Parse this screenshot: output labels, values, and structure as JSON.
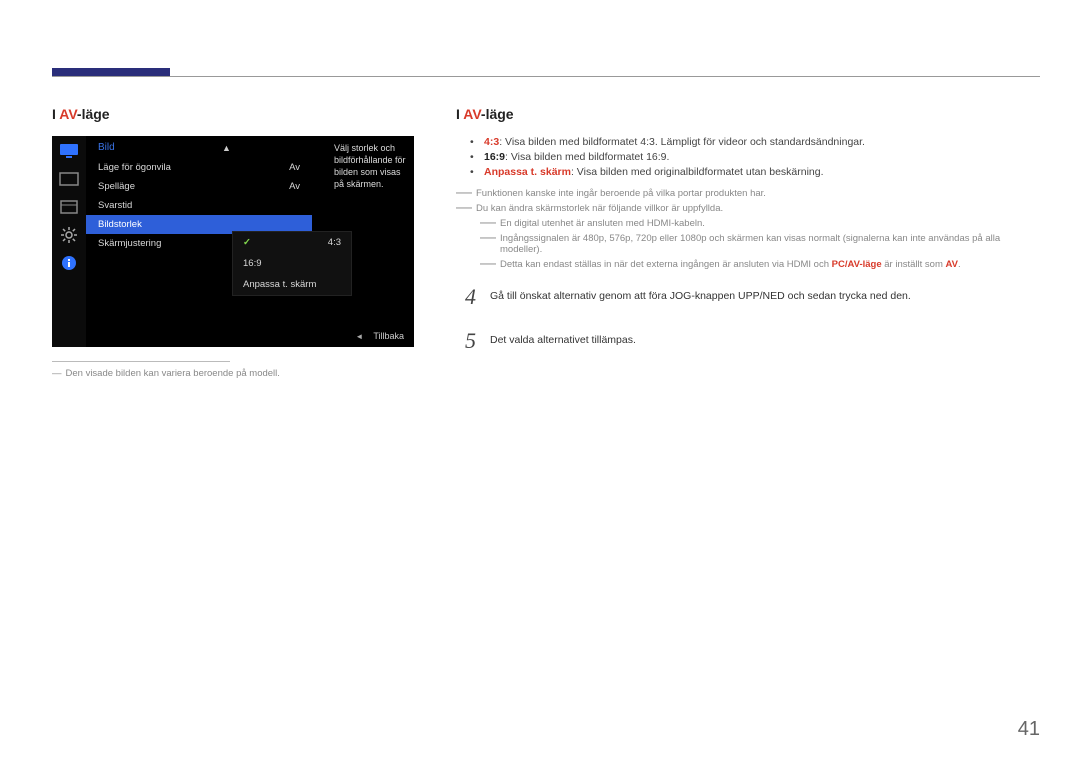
{
  "page_number": "41",
  "left": {
    "heading_prefix": "I ",
    "heading_accent": "AV",
    "heading_suffix": "-läge",
    "osd": {
      "title": "Bild",
      "help": "Välj storlek och bildförhållande för bilden som visas på skärmen.",
      "rows": [
        {
          "label": "Läge för ögonvila",
          "value": "Av"
        },
        {
          "label": "Spelläge",
          "value": "Av"
        },
        {
          "label": "Svarstid",
          "value": ""
        },
        {
          "label": "Bildstorlek",
          "value": ""
        },
        {
          "label": "Skärmjustering",
          "value": ""
        }
      ],
      "selected_index": 3,
      "submenu": [
        "4:3",
        "16:9",
        "Anpassa t. skärm"
      ],
      "submenu_selected": 0,
      "footer_back": "Tillbaka"
    },
    "footnote": "Den visade bilden kan variera beroende på modell."
  },
  "right": {
    "heading_prefix": "I ",
    "heading_accent": "AV",
    "heading_suffix": "-läge",
    "bullets": [
      {
        "lead": "4:3",
        "lead_color": "red",
        "text": ": Visa bilden med bildformatet 4:3. Lämpligt för videor och standardsändningar."
      },
      {
        "lead": "16:9",
        "lead_color": "black",
        "text": ": Visa bilden med bildformatet 16:9."
      },
      {
        "lead": "Anpassa t. skärm",
        "lead_color": "red",
        "text": ": Visa bilden med originalbildformatet utan beskärning."
      }
    ],
    "notes": [
      {
        "indent": 0,
        "text": "Funktionen kanske inte ingår beroende på vilka portar produkten har."
      },
      {
        "indent": 0,
        "text": "Du kan ändra skärmstorlek när följande villkor är uppfyllda."
      },
      {
        "indent": 1,
        "text": "En digital utenhet är ansluten med HDMI-kabeln."
      },
      {
        "indent": 1,
        "text": "Ingångssignalen är 480p, 576p, 720p eller 1080p och skärmen kan visas normalt (signalerna kan inte användas på alla modeller)."
      },
      {
        "indent": 1,
        "rich": [
          {
            "t": "Detta kan endast ställas in när det externa ingången är ansluten via HDMI och "
          },
          {
            "t": "PC/AV-läge",
            "cls": "hl"
          },
          {
            "t": " är inställt som "
          },
          {
            "t": "AV",
            "cls": "hl"
          },
          {
            "t": "."
          }
        ]
      }
    ],
    "steps": [
      {
        "n": "4",
        "text": "Gå till önskat alternativ genom att föra JOG-knappen UPP/NED och sedan trycka ned den."
      },
      {
        "n": "5",
        "text": "Det valda alternativet tillämpas."
      }
    ]
  }
}
